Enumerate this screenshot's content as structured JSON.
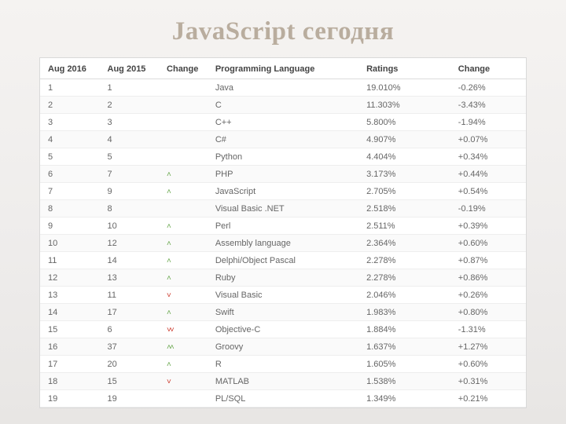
{
  "title": "JavaScript сегодня",
  "columns": [
    "Aug 2016",
    "Aug 2015",
    "Change",
    "Programming Language",
    "Ratings",
    "Change"
  ],
  "icons": {
    "up": "˄",
    "down": "˅",
    "double_up": "˄˄",
    "double_down": "˅˅"
  },
  "rows": [
    {
      "r2016": "1",
      "r2015": "1",
      "trend": "",
      "lang": "Java",
      "rating": "19.010%",
      "change": "-0.26%"
    },
    {
      "r2016": "2",
      "r2015": "2",
      "trend": "",
      "lang": "C",
      "rating": "11.303%",
      "change": "-3.43%"
    },
    {
      "r2016": "3",
      "r2015": "3",
      "trend": "",
      "lang": "C++",
      "rating": "5.800%",
      "change": "-1.94%"
    },
    {
      "r2016": "4",
      "r2015": "4",
      "trend": "",
      "lang": "C#",
      "rating": "4.907%",
      "change": "+0.07%"
    },
    {
      "r2016": "5",
      "r2015": "5",
      "trend": "",
      "lang": "Python",
      "rating": "4.404%",
      "change": "+0.34%"
    },
    {
      "r2016": "6",
      "r2015": "7",
      "trend": "up",
      "lang": "PHP",
      "rating": "3.173%",
      "change": "+0.44%"
    },
    {
      "r2016": "7",
      "r2015": "9",
      "trend": "up",
      "lang": "JavaScript",
      "rating": "2.705%",
      "change": "+0.54%"
    },
    {
      "r2016": "8",
      "r2015": "8",
      "trend": "",
      "lang": "Visual Basic .NET",
      "rating": "2.518%",
      "change": "-0.19%"
    },
    {
      "r2016": "9",
      "r2015": "10",
      "trend": "up",
      "lang": "Perl",
      "rating": "2.511%",
      "change": "+0.39%"
    },
    {
      "r2016": "10",
      "r2015": "12",
      "trend": "up",
      "lang": "Assembly language",
      "rating": "2.364%",
      "change": "+0.60%"
    },
    {
      "r2016": "11",
      "r2015": "14",
      "trend": "up",
      "lang": "Delphi/Object Pascal",
      "rating": "2.278%",
      "change": "+0.87%"
    },
    {
      "r2016": "12",
      "r2015": "13",
      "trend": "up",
      "lang": "Ruby",
      "rating": "2.278%",
      "change": "+0.86%"
    },
    {
      "r2016": "13",
      "r2015": "11",
      "trend": "down",
      "lang": "Visual Basic",
      "rating": "2.046%",
      "change": "+0.26%"
    },
    {
      "r2016": "14",
      "r2015": "17",
      "trend": "up",
      "lang": "Swift",
      "rating": "1.983%",
      "change": "+0.80%"
    },
    {
      "r2016": "15",
      "r2015": "6",
      "trend": "double_down",
      "lang": "Objective-C",
      "rating": "1.884%",
      "change": "-1.31%"
    },
    {
      "r2016": "16",
      "r2015": "37",
      "trend": "double_up",
      "lang": "Groovy",
      "rating": "1.637%",
      "change": "+1.27%"
    },
    {
      "r2016": "17",
      "r2015": "20",
      "trend": "up",
      "lang": "R",
      "rating": "1.605%",
      "change": "+0.60%"
    },
    {
      "r2016": "18",
      "r2015": "15",
      "trend": "down",
      "lang": "MATLAB",
      "rating": "1.538%",
      "change": "+0.31%"
    },
    {
      "r2016": "19",
      "r2015": "19",
      "trend": "",
      "lang": "PL/SQL",
      "rating": "1.349%",
      "change": "+0.21%"
    }
  ]
}
